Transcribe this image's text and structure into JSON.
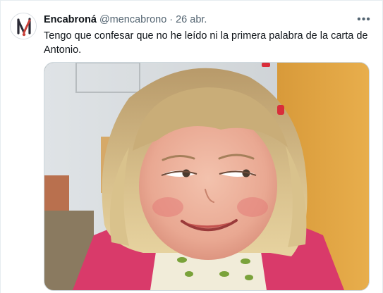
{
  "tweet": {
    "author_name": "Encabroná",
    "author_handle": "@mencabrono",
    "separator": "·",
    "date": "26 abr.",
    "more_label": "•••",
    "text": "Tengo que confesar que no he leído ni la primera palabra de la carta de Antonio."
  },
  "media": {
    "kind": "photo",
    "subject": "meme-photo"
  }
}
